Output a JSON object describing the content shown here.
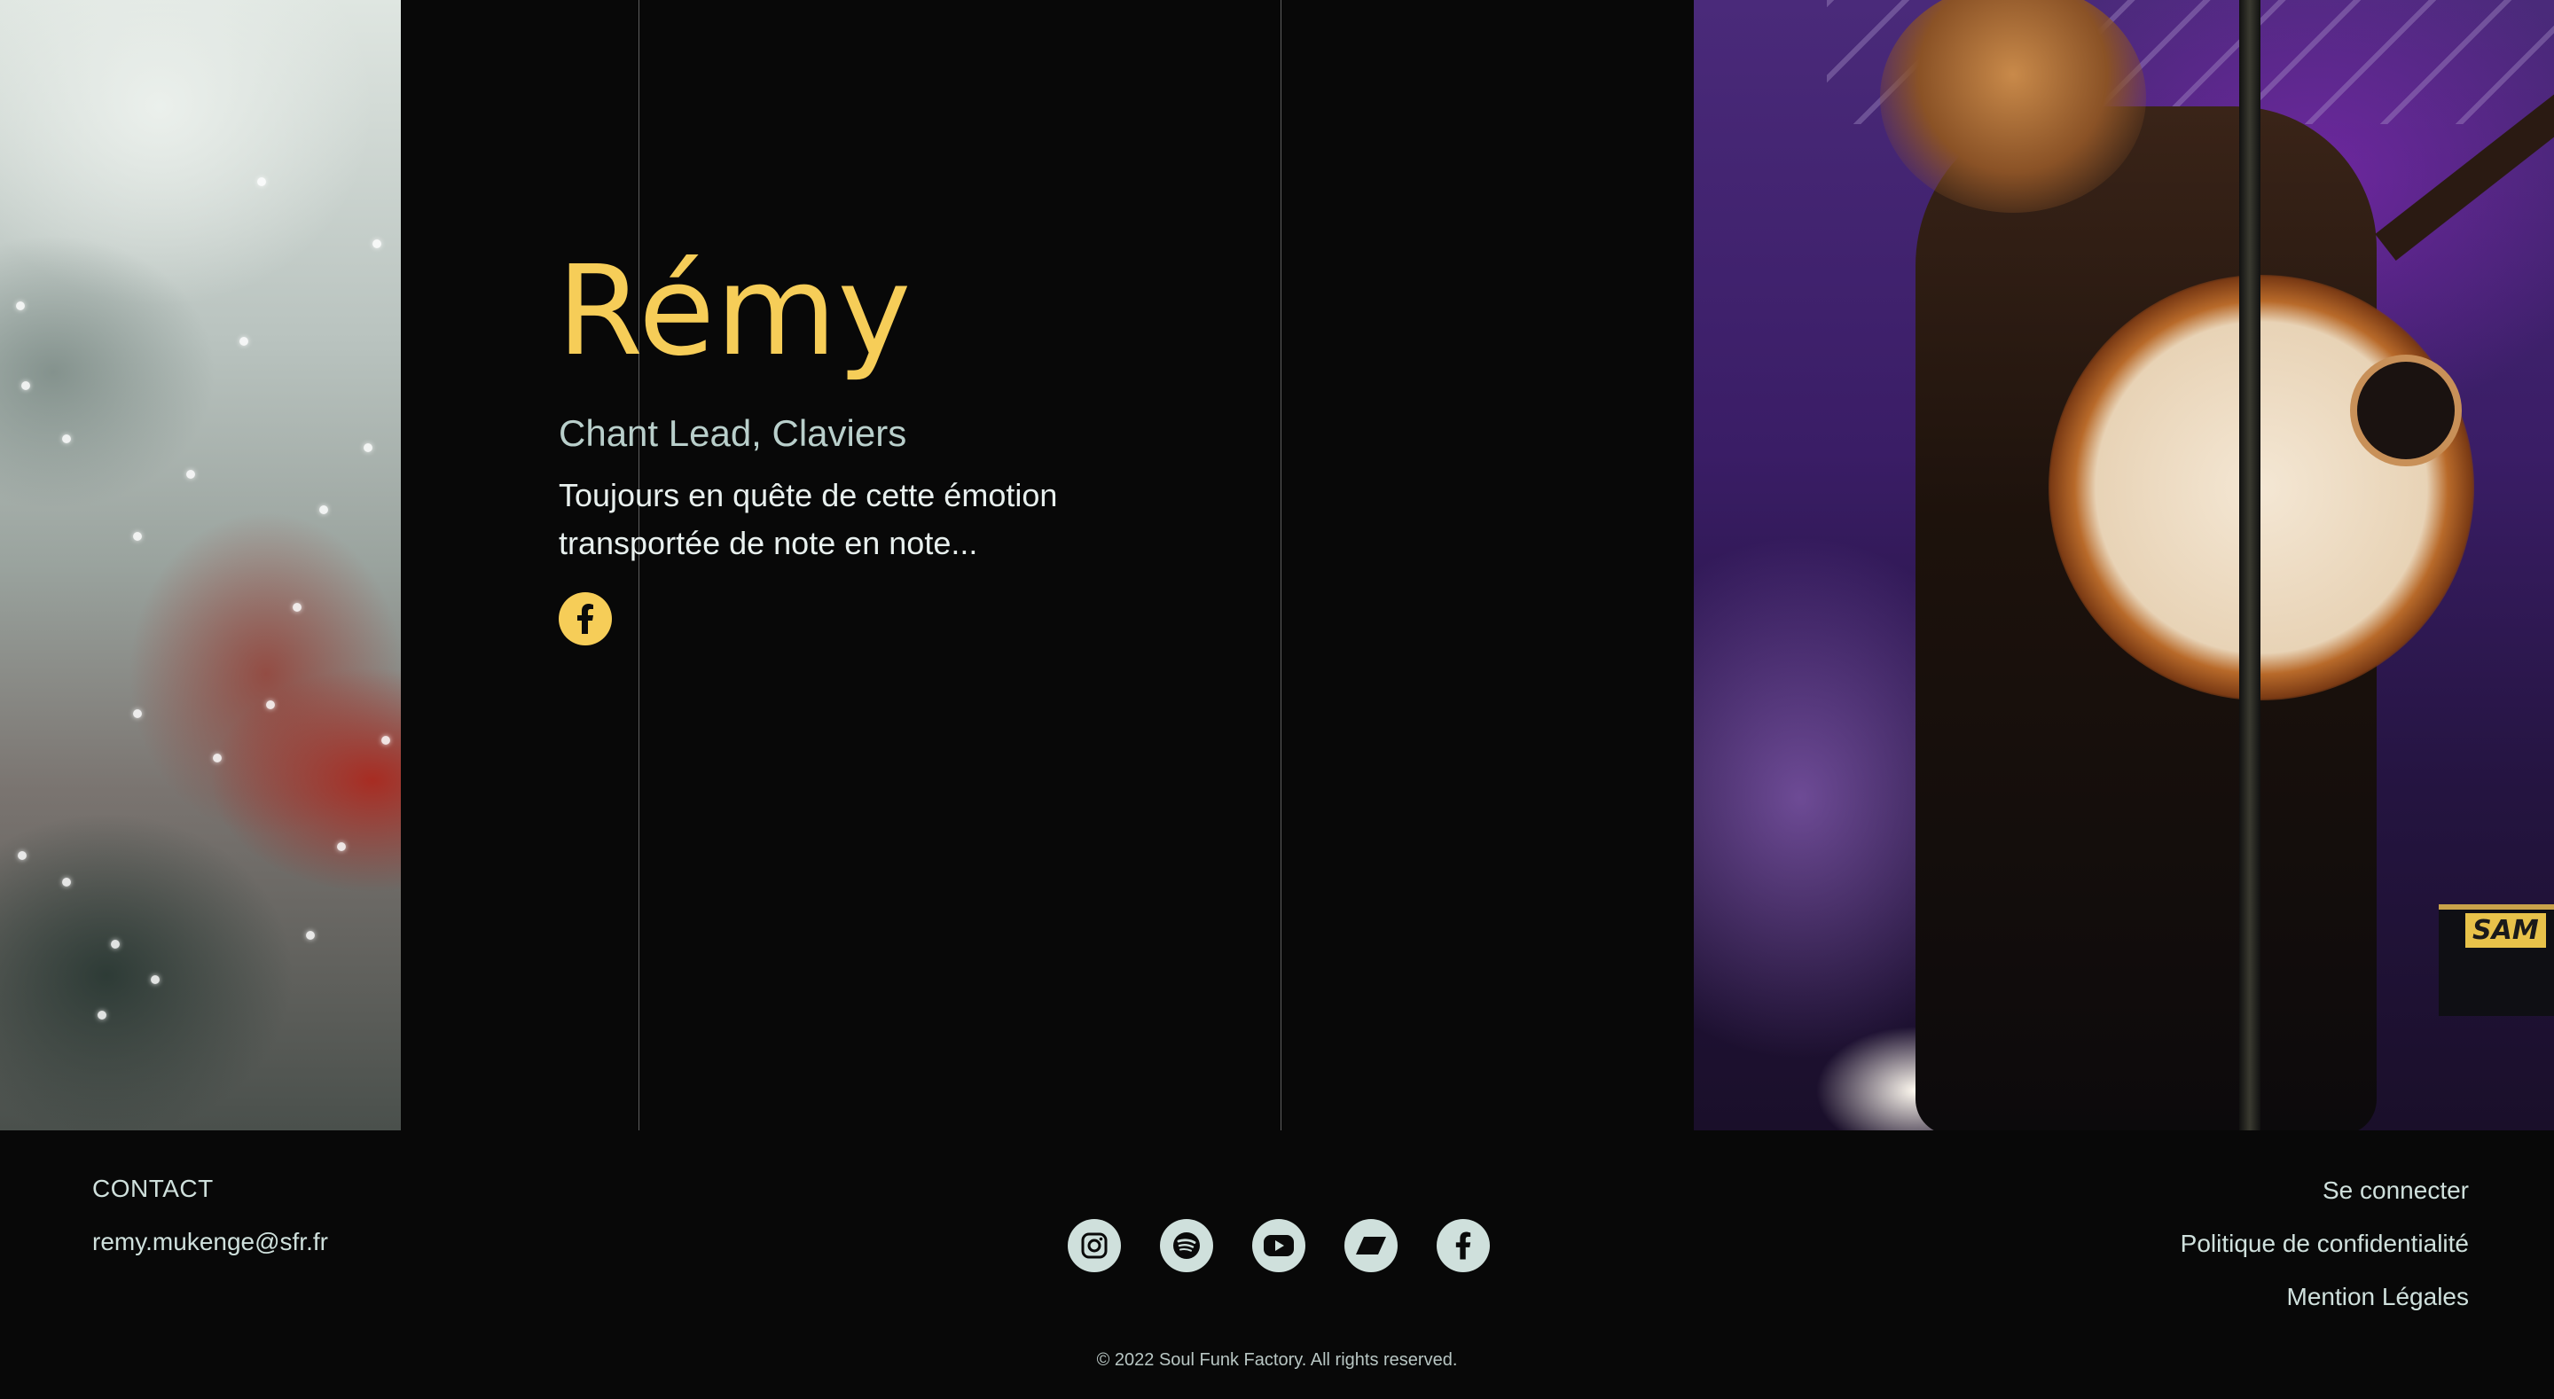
{
  "member": {
    "name": "Rémy",
    "role": "Chant Lead, Claviers",
    "bio": "Toujours en quête de cette émotion transportée de note en note...",
    "social_icon": "facebook-icon"
  },
  "photos": {
    "left_alt": "smoke",
    "right_alt": "performer with guitar",
    "keyboard_brand": "SAM"
  },
  "footer": {
    "contact_heading": "CONTACT",
    "email": "remy.mukenge@sfr.fr",
    "social_icons": [
      "instagram-icon",
      "spotify-icon",
      "youtube-icon",
      "bandcamp-icon",
      "facebook-icon"
    ],
    "links": {
      "login": "Se connecter",
      "privacy": "Politique de confidentialité",
      "legal": "Mention Légales"
    },
    "copyright": "© 2022 Soul Funk Factory. All rights reserved."
  },
  "colors": {
    "accent": "#f6cd58",
    "background": "#080808",
    "text": "#cfe0dc"
  }
}
